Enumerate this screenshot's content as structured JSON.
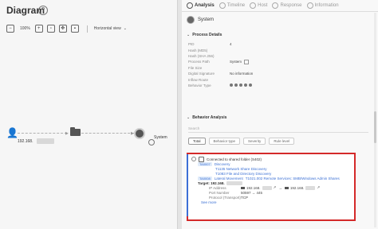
{
  "diagram": {
    "title": "Diagram",
    "help": "?",
    "toolbar": {
      "zoom": "100%",
      "view": "Horizontal view"
    },
    "nodes": {
      "user_ip": "192.168.",
      "system_label": "System"
    }
  },
  "panel": {
    "tabs": [
      {
        "label": "Analysis",
        "active": true,
        "icon": "analysis-icon"
      },
      {
        "label": "Timeline",
        "active": false,
        "icon": "timeline-icon"
      },
      {
        "label": "Host",
        "active": false,
        "icon": "host-icon"
      },
      {
        "label": "Response",
        "active": false,
        "icon": "response-icon"
      },
      {
        "label": "Information",
        "active": false,
        "icon": "info-icon"
      }
    ],
    "header": {
      "name": "System"
    },
    "process_details": {
      "title": "Process Details",
      "rows": [
        {
          "label": "PID",
          "value": "4"
        },
        {
          "label": "Hash (MD5)",
          "value": ""
        },
        {
          "label": "Hash (SHA 256)",
          "value": ""
        },
        {
          "label": "Process Path",
          "value": "System"
        },
        {
          "label": "File Size",
          "value": ""
        },
        {
          "label": "Digital Signature",
          "value": "No information"
        },
        {
          "label": "Inflow Route",
          "value": ""
        },
        {
          "label": "Behavior Type",
          "value": ""
        }
      ]
    },
    "behavior_analysis": {
      "title": "Behavior Analysis",
      "search_placeholder": "Search",
      "filters": [
        "Total",
        "Behavior type",
        "Severity",
        "Rule level"
      ],
      "item": {
        "title": "Connected to shared folder (S402)",
        "tactics": [
          {
            "badge": "TA0007",
            "label": "Discovery",
            "techniques": [
              "T1135 Network Share Discovery",
              "T1083 File and Directory Discovery"
            ]
          },
          {
            "badge": "TA0008",
            "label": "Lateral Movement",
            "techniques": [
              "T1021.002 Remote Services: SMB/Windows Admin Shares"
            ]
          }
        ],
        "target_label": "Target: 192.168.",
        "fields": [
          {
            "key": "IP Address",
            "value": "192.168.",
            "arrow": "→",
            "value2": "192.168."
          },
          {
            "key": "Port Number",
            "value": "50597 → 445"
          },
          {
            "key": "Protocol (Transport)",
            "value": "TCP"
          }
        ],
        "see_more": "See more"
      }
    }
  },
  "colors": {
    "accent": "#3a6fd4",
    "highlight": "#d42a2a"
  }
}
